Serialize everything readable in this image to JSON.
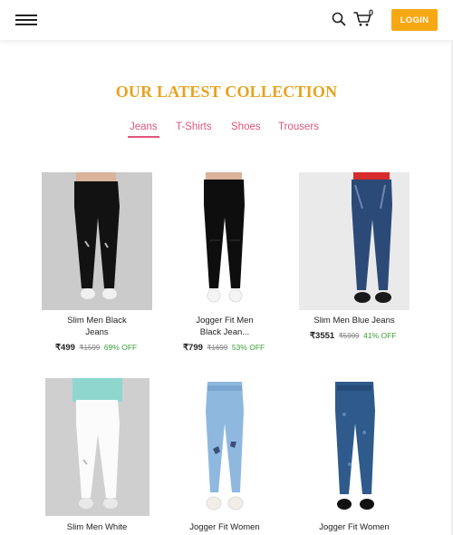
{
  "header": {
    "menu_icon": "hamburger-icon",
    "search_icon": "search-icon",
    "cart_icon": "cart-icon",
    "cart_count": "0",
    "login_label": "LOGIN",
    "accent": "#f7a813"
  },
  "section": {
    "title": "OUR LATEST COLLECTION",
    "title_color": "#e8a21f"
  },
  "tabs": [
    {
      "label": "Jeans",
      "active": true
    },
    {
      "label": "T-Shirts",
      "active": false
    },
    {
      "label": "Shoes",
      "active": false
    },
    {
      "label": "Trousers",
      "active": false
    }
  ],
  "tab_color": "#e0557a",
  "products": [
    {
      "name_l1": "Slim Men Black",
      "name_l2": "Jeans",
      "price": "₹499",
      "mrp": "₹1599",
      "off": "69% OFF"
    },
    {
      "name_l1": "Jogger Fit Men",
      "name_l2": "Black Jean...",
      "price": "₹799",
      "mrp": "₹1699",
      "off": "53% OFF"
    },
    {
      "name_l1": "Slim Men Blue Jeans",
      "name_l2": "",
      "price": "₹3551",
      "mrp": "₹5999",
      "off": "41% OFF"
    },
    {
      "name_l1": "Slim Men White",
      "name_l2": "",
      "price": "",
      "mrp": "",
      "off": ""
    },
    {
      "name_l1": "Jogger Fit Women",
      "name_l2": "",
      "price": "",
      "mrp": "",
      "off": ""
    },
    {
      "name_l1": "Jogger Fit Women",
      "name_l2": "",
      "price": "",
      "mrp": "",
      "off": ""
    }
  ],
  "off_color": "#3ca03c"
}
